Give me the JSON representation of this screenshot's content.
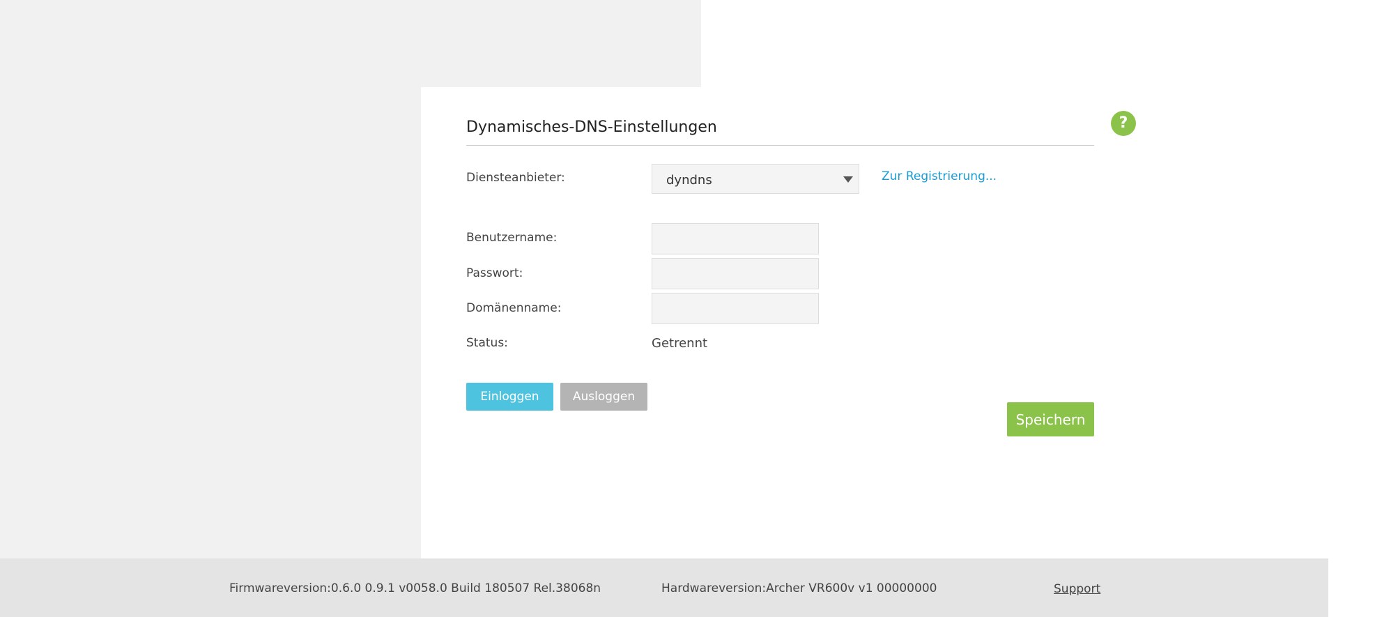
{
  "page": {
    "title": "Dynamisches-DNS-Einstellungen",
    "help_icon_name": "question-mark-icon"
  },
  "form": {
    "provider_label": "Diensteanbieter:",
    "provider_value": "dyndns",
    "register_link": "Zur Registrierung...",
    "username_label": "Benutzername:",
    "username_value": "",
    "password_label": "Passwort:",
    "password_value": "",
    "domain_label": "Domänenname:",
    "domain_value": "",
    "status_label": "Status:",
    "status_value": "Getrennt"
  },
  "buttons": {
    "login": "Einloggen",
    "logout": "Ausloggen",
    "save": "Speichern"
  },
  "footer": {
    "firmware": "Firmwareversion:0.6.0 0.9.1 v0058.0 Build 180507 Rel.38068n",
    "hardware": "Hardwareversion:Archer VR600v v1 00000000",
    "support": "Support"
  },
  "colors": {
    "accent_blue": "#4dc3e0",
    "accent_green": "#8bc34a",
    "link_blue": "#1a9cd3",
    "disabled_gray": "#b4b4b4"
  }
}
